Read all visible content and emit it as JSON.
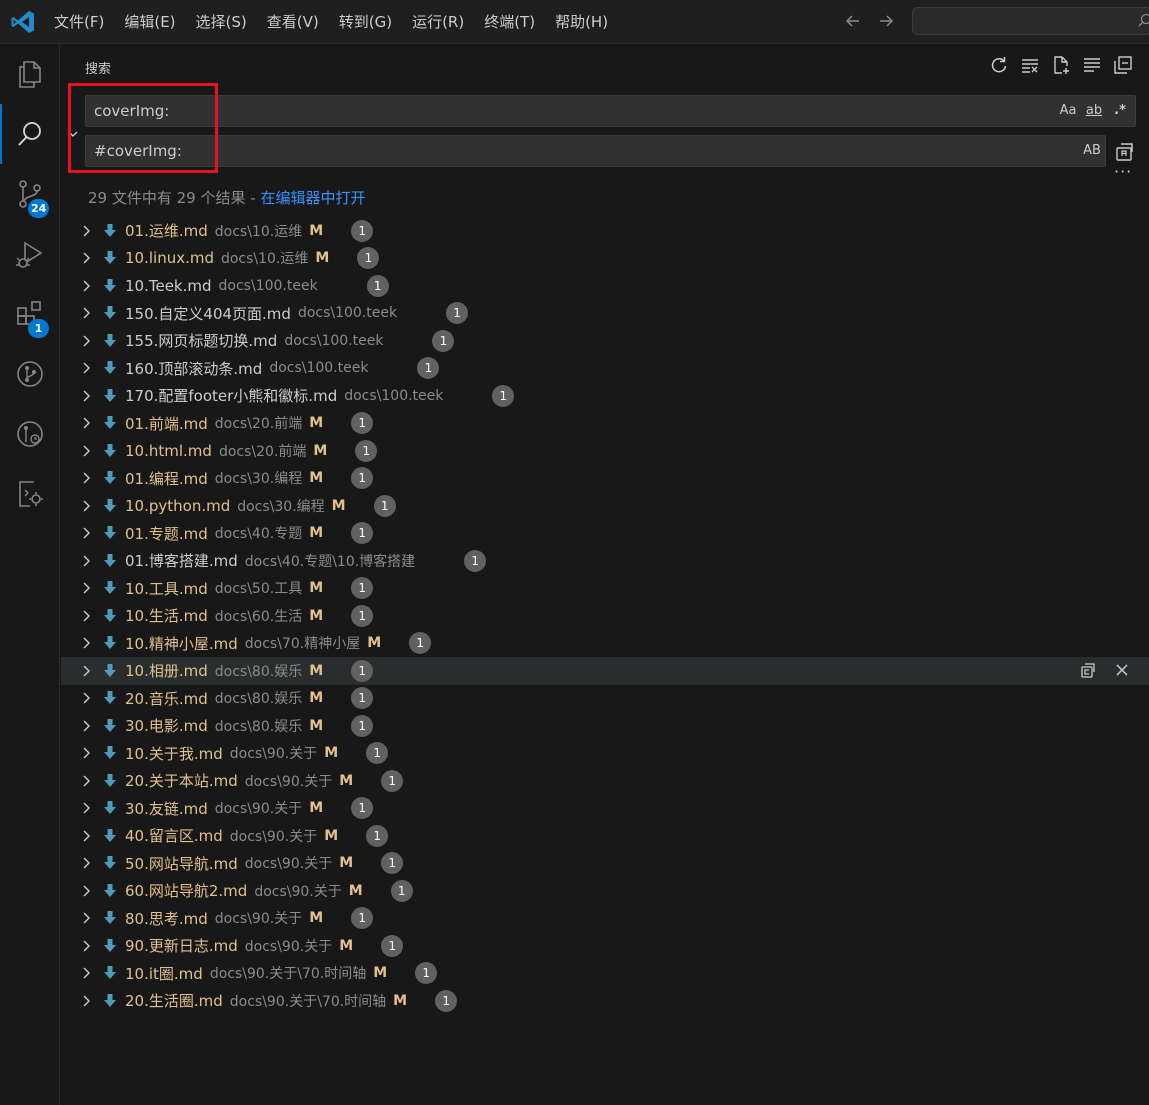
{
  "menu": [
    "文件(F)",
    "编辑(E)",
    "选择(S)",
    "查看(V)",
    "转到(G)",
    "运行(R)",
    "终端(T)",
    "帮助(H)"
  ],
  "sidebar": {
    "title": "搜索"
  },
  "activity": {
    "scm_badge": "24",
    "extensions_badge": "1"
  },
  "search": {
    "query": "coverImg:",
    "replace": "#coverImg:",
    "options": {
      "match_case": "Aa",
      "whole_word": "ab",
      "regex": ".*",
      "preserve_case": "AB"
    }
  },
  "summary": {
    "text": "29 文件中有 29 个结果 - ",
    "link": "在编辑器中打开"
  },
  "colors": {
    "accent": "#0078d4",
    "modified": "#e2c08d",
    "highlight": "#e81123",
    "link": "#3794ff"
  },
  "results": [
    {
      "name": "01.运维.md",
      "path": "docs\\10.运维",
      "status": "M",
      "count": "1"
    },
    {
      "name": "10.linux.md",
      "path": "docs\\10.运维",
      "status": "M",
      "count": "1"
    },
    {
      "name": "10.Teek.md",
      "path": "docs\\100.teek",
      "status": "",
      "count": "1"
    },
    {
      "name": "150.自定义404页面.md",
      "path": "docs\\100.teek",
      "status": "",
      "count": "1"
    },
    {
      "name": "155.网页标题切换.md",
      "path": "docs\\100.teek",
      "status": "",
      "count": "1"
    },
    {
      "name": "160.顶部滚动条.md",
      "path": "docs\\100.teek",
      "status": "",
      "count": "1"
    },
    {
      "name": "170.配置footer小熊和徽标.md",
      "path": "docs\\100.teek",
      "status": "",
      "count": "1"
    },
    {
      "name": "01.前端.md",
      "path": "docs\\20.前端",
      "status": "M",
      "count": "1"
    },
    {
      "name": "10.html.md",
      "path": "docs\\20.前端",
      "status": "M",
      "count": "1"
    },
    {
      "name": "01.编程.md",
      "path": "docs\\30.编程",
      "status": "M",
      "count": "1"
    },
    {
      "name": "10.python.md",
      "path": "docs\\30.编程",
      "status": "M",
      "count": "1"
    },
    {
      "name": "01.专题.md",
      "path": "docs\\40.专题",
      "status": "M",
      "count": "1"
    },
    {
      "name": "01.博客搭建.md",
      "path": "docs\\40.专题\\10.博客搭建",
      "status": "",
      "count": "1"
    },
    {
      "name": "10.工具.md",
      "path": "docs\\50.工具",
      "status": "M",
      "count": "1"
    },
    {
      "name": "10.生活.md",
      "path": "docs\\60.生活",
      "status": "M",
      "count": "1"
    },
    {
      "name": "10.精神小屋.md",
      "path": "docs\\70.精神小屋",
      "status": "M",
      "count": "1"
    },
    {
      "name": "10.相册.md",
      "path": "docs\\80.娱乐",
      "status": "M",
      "count": "1"
    },
    {
      "name": "20.音乐.md",
      "path": "docs\\80.娱乐",
      "status": "M",
      "count": "1"
    },
    {
      "name": "30.电影.md",
      "path": "docs\\80.娱乐",
      "status": "M",
      "count": "1"
    },
    {
      "name": "10.关于我.md",
      "path": "docs\\90.关于",
      "status": "M",
      "count": "1"
    },
    {
      "name": "20.关于本站.md",
      "path": "docs\\90.关于",
      "status": "M",
      "count": "1"
    },
    {
      "name": "30.友链.md",
      "path": "docs\\90.关于",
      "status": "M",
      "count": "1"
    },
    {
      "name": "40.留言区.md",
      "path": "docs\\90.关于",
      "status": "M",
      "count": "1"
    },
    {
      "name": "50.网站导航.md",
      "path": "docs\\90.关于",
      "status": "M",
      "count": "1"
    },
    {
      "name": "60.网站导航2.md",
      "path": "docs\\90.关于",
      "status": "M",
      "count": "1"
    },
    {
      "name": "80.思考.md",
      "path": "docs\\90.关于",
      "status": "M",
      "count": "1"
    },
    {
      "name": "90.更新日志.md",
      "path": "docs\\90.关于",
      "status": "M",
      "count": "1"
    },
    {
      "name": "10.it圈.md",
      "path": "docs\\90.关于\\70.时间轴",
      "status": "M",
      "count": "1"
    },
    {
      "name": "20.生活圈.md",
      "path": "docs\\90.关于\\70.时间轴",
      "status": "M",
      "count": "1"
    }
  ]
}
